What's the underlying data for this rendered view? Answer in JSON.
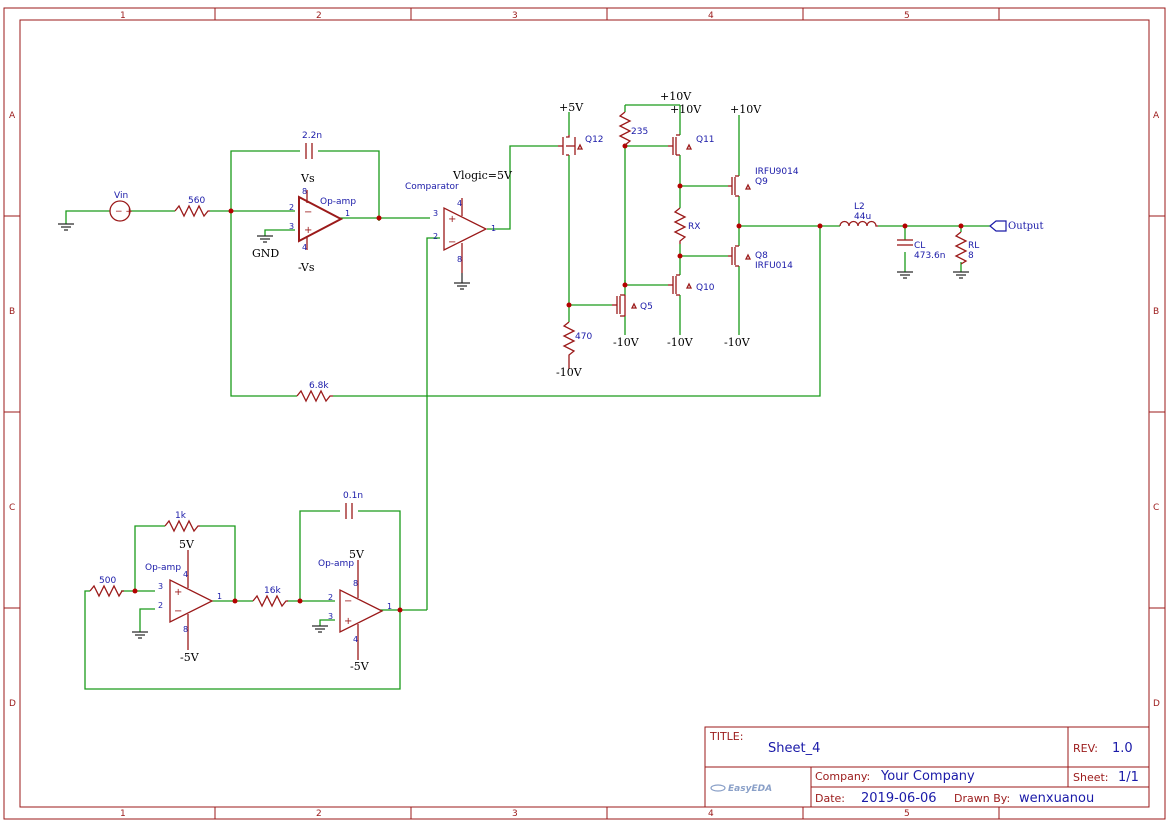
{
  "frame": {
    "columns": [
      "1",
      "2",
      "3",
      "4",
      "5"
    ],
    "rows": [
      "A",
      "B",
      "C",
      "D"
    ]
  },
  "title_block": {
    "title_label": "TITLE:",
    "title": "Sheet_4",
    "rev_label": "REV:",
    "rev": "1.0",
    "company_label": "Company:",
    "company": "Your Company",
    "sheet_label": "Sheet:",
    "sheet": "1/1",
    "date_label": "Date:",
    "date": "2019-06-06",
    "drawn_label": "Drawn By:",
    "drawn_by": "wenxuanou",
    "logo": "EasyEDA"
  },
  "labels": {
    "vin": "Vin",
    "r560": "560",
    "c22n": "2.2n",
    "vs": "Vs",
    "neg_vs": "-Vs",
    "gnd": "GND",
    "opamp": "Op-amp",
    "comparator": "Comparator",
    "vlogic": "Vlogic=5V",
    "r68k": "6.8k",
    "p5v": "+5V",
    "p10v_a": "+10V",
    "p10v_b": "+10V",
    "p10v_c": "+10V",
    "r235": "235",
    "r470": "470",
    "n10v_a": "-10V",
    "n10v_b": "-10V",
    "n10v_c": "-10V",
    "n10v_d": "-10V",
    "q12": "Q12",
    "q11": "Q11",
    "q10": "Q10",
    "q5": "Q5",
    "q9": "Q9",
    "q9_part": "IRFU9014",
    "q8": "Q8",
    "q8_part": "IRFU014",
    "rx": "RX",
    "l2": "L2",
    "l2_val": "44u",
    "cl": "CL",
    "cl_val": "473.6n",
    "rl": "RL",
    "rl_val": "8",
    "output": "Output",
    "r1k": "1k",
    "r500": "500",
    "r16k": "16k",
    "c01n": "0.1n",
    "v5_a": "5V",
    "v5_b": "5V",
    "nv5_a": "-5V",
    "nv5_b": "-5V",
    "opamp2": "Op-amp",
    "opamp3": "Op-amp"
  }
}
